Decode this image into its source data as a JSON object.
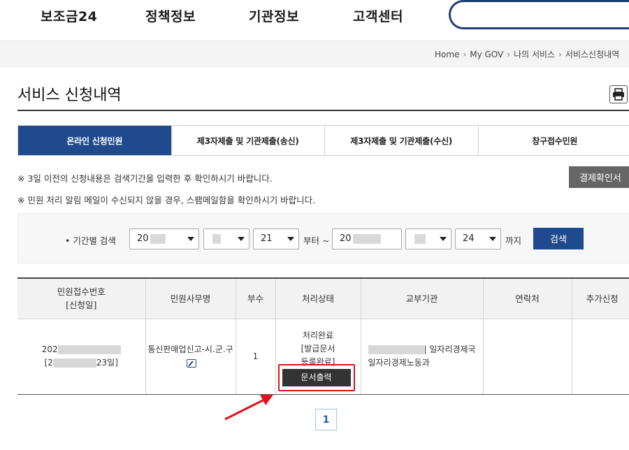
{
  "nav": {
    "items": [
      "보조금24",
      "정책정보",
      "기관정보",
      "고객센터"
    ],
    "search_placeholder": ""
  },
  "breadcrumb": [
    "Home",
    "My GOV",
    "나의 서비스",
    "서비스신청내역"
  ],
  "page": {
    "title": "서비스 신청내역"
  },
  "tabs": [
    "온라인 신청민원",
    "제3자제출 및 기관제출(송신)",
    "제3자제출 및 기관제출(수신)",
    "창구접수민원"
  ],
  "notices": [
    "※ 3일 이전의 신청내용은 검색기간을 입력한 후 확인하시기 바랍니다.",
    "※ 민원 처리 알림 메일이 수신되지 않을 경우, 스팸메일함을 확인하시기 바랍니다."
  ],
  "receipt_button": "결제확인서",
  "search": {
    "label": "• 기간별 검색",
    "start_year": "20",
    "start_day": "21",
    "from_text": "부터 ~",
    "end_year": "20",
    "end_day": "24",
    "until_text": "까지",
    "button": "검색"
  },
  "table": {
    "headers": {
      "receipt_no": "민원접수번호",
      "apply_date": "[신청일]",
      "service_name": "민원사무명",
      "copies": "부수",
      "status": "처리상태",
      "agency": "교부기관",
      "contact": "연락처",
      "extra": "추가신청"
    },
    "rows": [
      {
        "receipt_no_prefix": "202",
        "apply_date_prefix": "[2",
        "apply_date_suffix": "23일]",
        "service_name": "통신판매업신고-시.군.구",
        "copies": "1",
        "status_line1": "처리완료",
        "status_line2": "[발급문서",
        "status_line3": "등록완료]",
        "print_button": "문서출력",
        "agency_line1": "| 일자리경제국",
        "agency_line2": "일자리경제노동과"
      }
    ]
  },
  "pagination": {
    "current": "1"
  },
  "colors": {
    "primary": "#1f4b8e",
    "highlight": "#e0121b"
  }
}
